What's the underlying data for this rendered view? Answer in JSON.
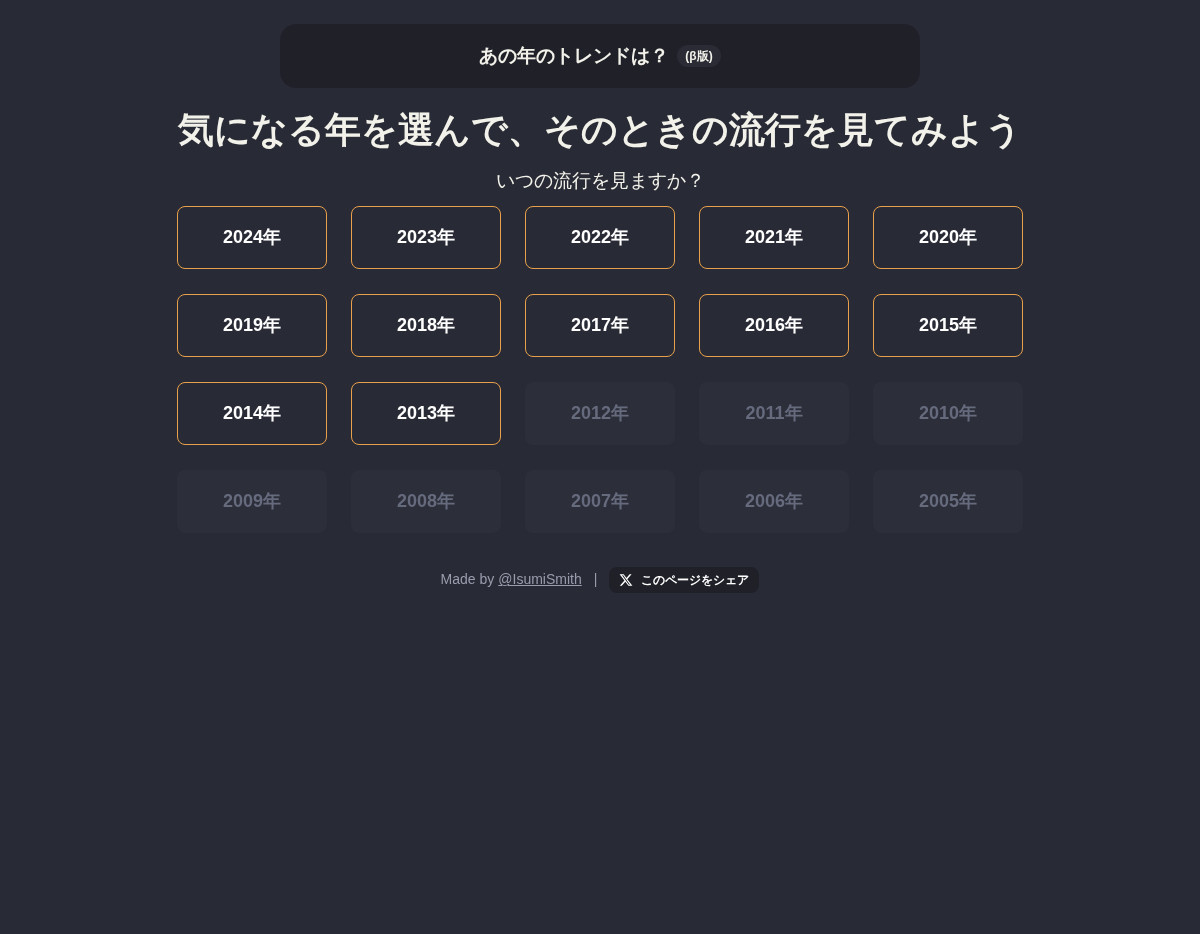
{
  "header": {
    "title": "あの年のトレンドは？",
    "badge": "(β版)"
  },
  "heading": "気になる年を選んで、そのときの流行を見てみよう",
  "question": "いつの流行を見ますか？",
  "years": [
    {
      "label": "2024年",
      "disabled": false
    },
    {
      "label": "2023年",
      "disabled": false
    },
    {
      "label": "2022年",
      "disabled": false
    },
    {
      "label": "2021年",
      "disabled": false
    },
    {
      "label": "2020年",
      "disabled": false
    },
    {
      "label": "2019年",
      "disabled": false
    },
    {
      "label": "2018年",
      "disabled": false
    },
    {
      "label": "2017年",
      "disabled": false
    },
    {
      "label": "2016年",
      "disabled": false
    },
    {
      "label": "2015年",
      "disabled": false
    },
    {
      "label": "2014年",
      "disabled": false
    },
    {
      "label": "2013年",
      "disabled": false
    },
    {
      "label": "2012年",
      "disabled": true
    },
    {
      "label": "2011年",
      "disabled": true
    },
    {
      "label": "2010年",
      "disabled": true
    },
    {
      "label": "2009年",
      "disabled": true
    },
    {
      "label": "2008年",
      "disabled": true
    },
    {
      "label": "2007年",
      "disabled": true
    },
    {
      "label": "2006年",
      "disabled": true
    },
    {
      "label": "2005年",
      "disabled": true
    }
  ],
  "footer": {
    "made_by": "Made by",
    "author_link": "@IsumiSmith",
    "separator": "|",
    "share_button": "このページをシェア"
  }
}
